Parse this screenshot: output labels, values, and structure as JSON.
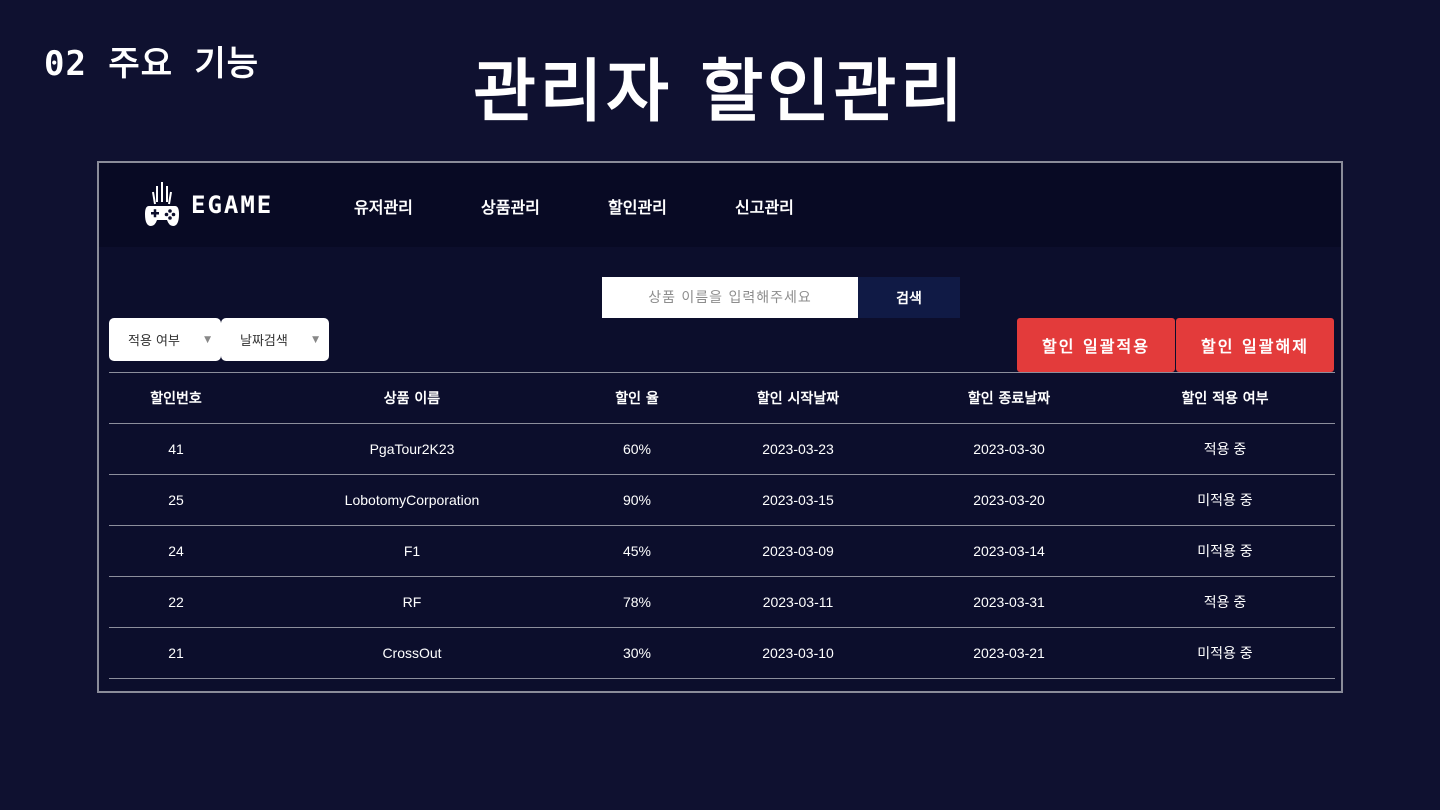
{
  "slide": {
    "section_label": "02 주요 기능",
    "title": "관리자 할인관리"
  },
  "app": {
    "logo_text": "EGAME",
    "nav": [
      {
        "label": "유저관리"
      },
      {
        "label": "상품관리"
      },
      {
        "label": "할인관리"
      },
      {
        "label": "신고관리"
      }
    ]
  },
  "search": {
    "placeholder": "상품 이름을 입력해주세요",
    "value": "",
    "button_label": "검색"
  },
  "filters": {
    "apply_status": {
      "label": "적용 여부",
      "chevron": "chevron-down-icon"
    },
    "date_search": {
      "label": "날짜검색",
      "chevron": "chevron-down-icon"
    }
  },
  "actions": {
    "bulk_apply_label": "할인 일괄적용",
    "bulk_release_label": "할인 일괄해제",
    "color": "#e33b3b"
  },
  "table": {
    "headers": [
      "할인번호",
      "상품 이름",
      "할인 율",
      "할인 시작날짜",
      "할인 종료날짜",
      "할인 적용 여부"
    ],
    "rows": [
      [
        "41",
        "PgaTour2K23",
        "60%",
        "2023-03-23",
        "2023-03-30",
        "적용 중"
      ],
      [
        "25",
        "LobotomyCorporation",
        "90%",
        "2023-03-15",
        "2023-03-20",
        "미적용 중"
      ],
      [
        "24",
        "F1",
        "45%",
        "2023-03-09",
        "2023-03-14",
        "미적용 중"
      ],
      [
        "22",
        "RF",
        "78%",
        "2023-03-11",
        "2023-03-31",
        "적용 중"
      ],
      [
        "21",
        "CrossOut",
        "30%",
        "2023-03-10",
        "2023-03-21",
        "미적용 중"
      ]
    ]
  },
  "colors": {
    "background": "#0f1130",
    "panel": "#0c0e2c",
    "navbar": "#080a24",
    "search_button": "#101a45",
    "accent_red": "#e33b3b"
  }
}
